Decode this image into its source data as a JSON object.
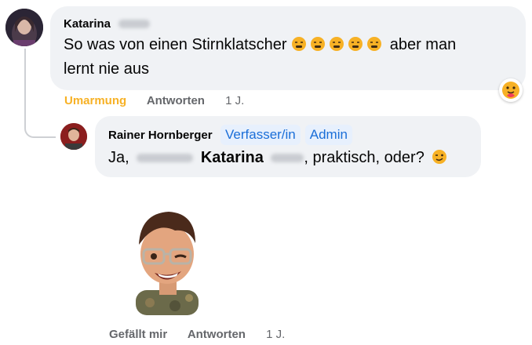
{
  "comment": {
    "author": "Katarina",
    "text": "So was von einen Stirnklatscher",
    "text_after_emojis": "aber man",
    "text_line2": "lernt nie aus",
    "emoji_count": 5,
    "reaction_icon": "care-reaction-icon",
    "actions": {
      "reaction_label": "Umarmung",
      "reply_label": "Antworten",
      "time": "1 J."
    }
  },
  "reply": {
    "author": "Rainer Hornberger",
    "badges": [
      "Verfasser/in",
      "Admin"
    ],
    "text_prefix": "Ja,",
    "mention": "Katarina",
    "text_suffix": ", praktisch, oder?",
    "actions": {
      "like_label": "Gefällt mir",
      "reply_label": "Antworten",
      "time": "1 J."
    }
  },
  "colors": {
    "bubble": "#f0f2f5",
    "badge_bg": "#e7f0fd",
    "badge_text": "#1a6ed8",
    "reaction_text": "#f7b125",
    "muted": "#65676b"
  }
}
